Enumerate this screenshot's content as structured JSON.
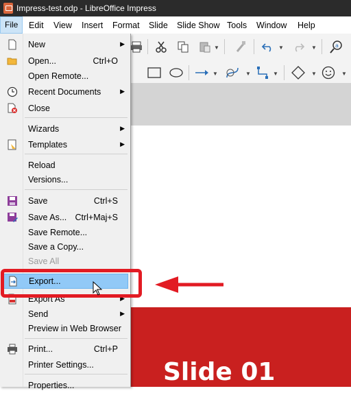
{
  "window": {
    "title": "Impress-test.odp - LibreOffice Impress",
    "app_icon": "impress-doc-icon"
  },
  "menubar": {
    "items": [
      "File",
      "Edit",
      "View",
      "Insert",
      "Format",
      "Slide",
      "Slide Show",
      "Tools",
      "Window",
      "Help"
    ]
  },
  "file_menu": {
    "items": [
      {
        "label": "New",
        "shortcut": "",
        "submenu": true,
        "icon": "new-doc-icon"
      },
      {
        "label": "Open...",
        "shortcut": "Ctrl+O",
        "submenu": false,
        "icon": "folder-icon"
      },
      {
        "label": "Open Remote...",
        "shortcut": "",
        "submenu": false,
        "icon": ""
      },
      {
        "label": "Recent Documents",
        "shortcut": "",
        "submenu": true,
        "icon": "clock-icon"
      },
      {
        "label": "Close",
        "shortcut": "",
        "submenu": false,
        "icon": "close-doc-icon"
      },
      {
        "label": "Wizards",
        "shortcut": "",
        "submenu": true,
        "icon": ""
      },
      {
        "label": "Templates",
        "shortcut": "",
        "submenu": true,
        "icon": "templates-icon"
      },
      {
        "label": "Reload",
        "shortcut": "",
        "submenu": false,
        "icon": ""
      },
      {
        "label": "Versions...",
        "shortcut": "",
        "submenu": false,
        "icon": ""
      },
      {
        "label": "Save",
        "shortcut": "Ctrl+S",
        "submenu": false,
        "icon": "save-icon"
      },
      {
        "label": "Save As...",
        "shortcut": "Ctrl+Maj+S",
        "submenu": false,
        "icon": "save-as-icon"
      },
      {
        "label": "Save Remote...",
        "shortcut": "",
        "submenu": false,
        "icon": ""
      },
      {
        "label": "Save a Copy...",
        "shortcut": "",
        "submenu": false,
        "icon": ""
      },
      {
        "label": "Save All",
        "shortcut": "",
        "submenu": false,
        "icon": "",
        "disabled": true
      },
      {
        "label": "Export...",
        "shortcut": "",
        "submenu": false,
        "icon": "export-icon",
        "highlighted": true
      },
      {
        "label": "Export As",
        "shortcut": "",
        "submenu": true,
        "icon": "export-pdf-icon"
      },
      {
        "label": "Send",
        "shortcut": "",
        "submenu": true,
        "icon": ""
      },
      {
        "label": "Preview in Web Browser",
        "shortcut": "",
        "submenu": false,
        "icon": ""
      },
      {
        "label": "Print...",
        "shortcut": "Ctrl+P",
        "submenu": false,
        "icon": "printer-icon"
      },
      {
        "label": "Printer Settings...",
        "shortcut": "",
        "submenu": false,
        "icon": ""
      },
      {
        "label": "Properties...",
        "shortcut": "",
        "submenu": false,
        "icon": ""
      }
    ]
  },
  "slide": {
    "title": "Slide 01"
  },
  "colors": {
    "accent_red": "#e21b23",
    "slide_red": "#c9201f",
    "highlight": "#91c9f7"
  }
}
